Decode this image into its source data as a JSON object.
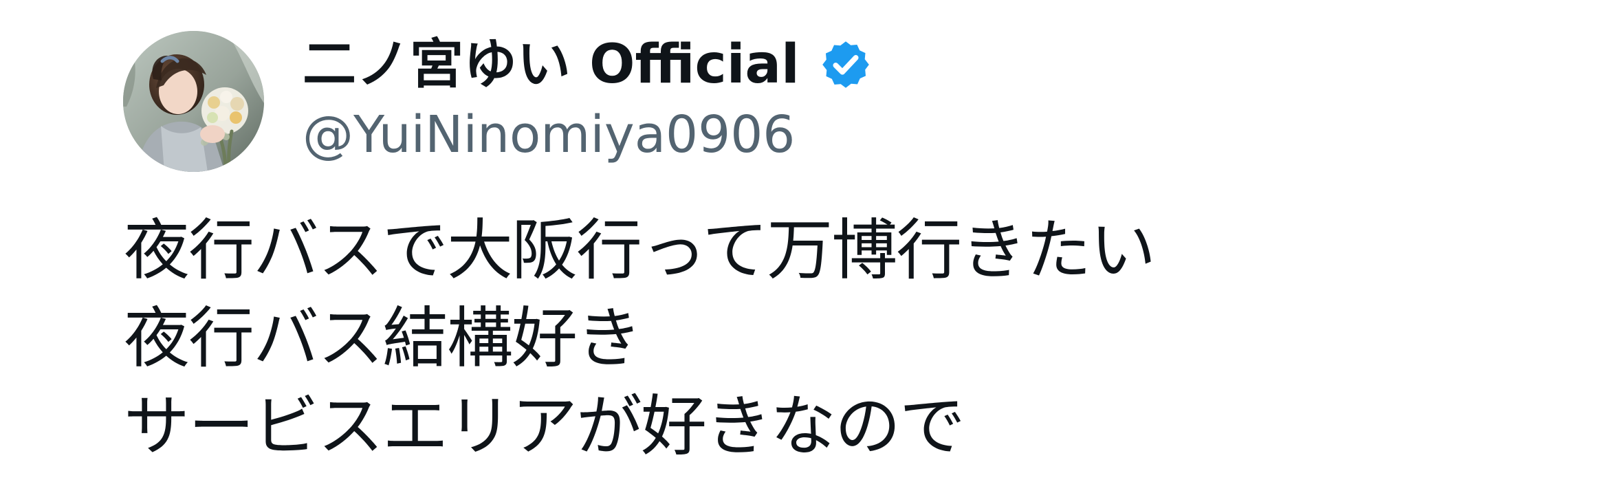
{
  "tweet": {
    "author": {
      "display_name": "二ノ宮ゆい Official",
      "handle": "@YuiNinomiya0906",
      "verified_icon": "verified-badge-icon",
      "avatar_icon": "profile-avatar"
    },
    "text_lines": [
      "夜行バスで大阪行って万博行きたい",
      "夜行バス結構好き",
      "サービスエリアが好きなので"
    ]
  },
  "colors": {
    "text_primary": "#0f1419",
    "text_secondary": "#536471",
    "verified_blue": "#1d9bf0",
    "background": "#ffffff"
  }
}
